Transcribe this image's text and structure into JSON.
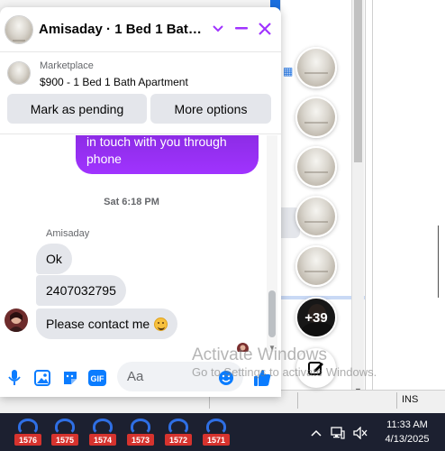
{
  "chat": {
    "title": "Amisaday · 1 Bed 1 Bath A...",
    "listing": {
      "source": "Marketplace",
      "title": "$900 - 1 Bed 1 Bath Apartment",
      "mark_pending_label": "Mark as pending",
      "more_options_label": "More options"
    },
    "messages": {
      "outgoing_tail": "in touch with you through phone",
      "timestamp": "Sat 6:18 PM",
      "sender_name": "Amisaday",
      "incoming": [
        "Ok",
        "2407032795",
        "Please contact me"
      ]
    },
    "composer": {
      "placeholder": "Aa"
    },
    "colors": {
      "accent": "#a033ff",
      "icon_blue": "#0a7cff"
    }
  },
  "chat_heads": {
    "more_count": "+39"
  },
  "watermark": {
    "line1": "Activate Windows",
    "line2": "Go to Settings to activate Windows."
  },
  "status_bar": {
    "ins": "INS"
  },
  "taskbar": {
    "apps": [
      "1576",
      "1575",
      "1574",
      "1573",
      "1572",
      "1571"
    ],
    "time": "11:33 AM",
    "date": "4/13/2025"
  }
}
